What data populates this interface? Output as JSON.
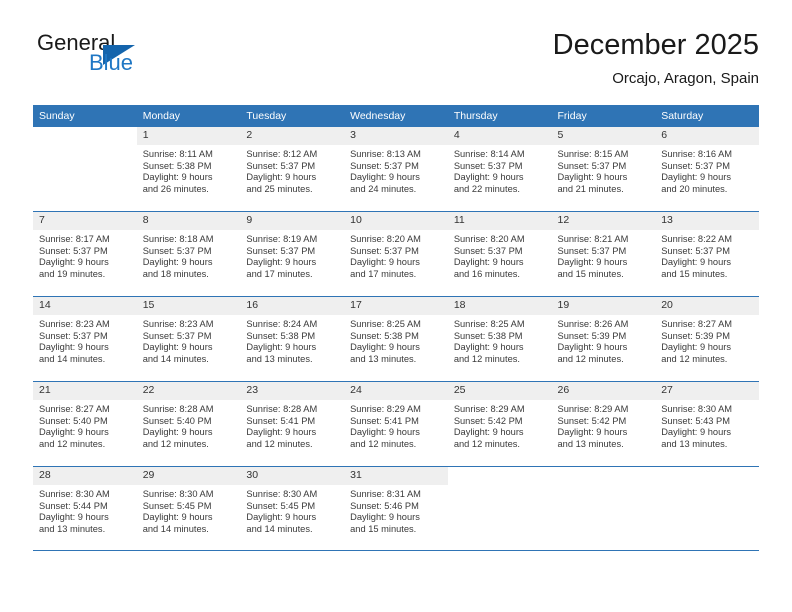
{
  "brand": {
    "name_part1": "General",
    "name_part2": "Blue",
    "logo_icon": "triangle-logo-icon",
    "accent_color": "#1464ac",
    "text_color": "#1f77c4"
  },
  "header": {
    "title": "December 2025",
    "subtitle": "Orcajo, Aragon, Spain"
  },
  "calendar": {
    "header_bg": "#2f74b5",
    "daynum_bg": "#efefef",
    "weekday_headers": [
      "Sunday",
      "Monday",
      "Tuesday",
      "Wednesday",
      "Thursday",
      "Friday",
      "Saturday"
    ],
    "weeks": [
      [
        {
          "day": "",
          "blank": true,
          "empty": false,
          "sunrise": "",
          "sunset": "",
          "daylight_line1": "",
          "daylight_line2": ""
        },
        {
          "day": "1",
          "sunrise": "Sunrise: 8:11 AM",
          "sunset": "Sunset: 5:38 PM",
          "daylight_line1": "Daylight: 9 hours",
          "daylight_line2": "and 26 minutes."
        },
        {
          "day": "2",
          "sunrise": "Sunrise: 8:12 AM",
          "sunset": "Sunset: 5:37 PM",
          "daylight_line1": "Daylight: 9 hours",
          "daylight_line2": "and 25 minutes."
        },
        {
          "day": "3",
          "sunrise": "Sunrise: 8:13 AM",
          "sunset": "Sunset: 5:37 PM",
          "daylight_line1": "Daylight: 9 hours",
          "daylight_line2": "and 24 minutes."
        },
        {
          "day": "4",
          "sunrise": "Sunrise: 8:14 AM",
          "sunset": "Sunset: 5:37 PM",
          "daylight_line1": "Daylight: 9 hours",
          "daylight_line2": "and 22 minutes."
        },
        {
          "day": "5",
          "sunrise": "Sunrise: 8:15 AM",
          "sunset": "Sunset: 5:37 PM",
          "daylight_line1": "Daylight: 9 hours",
          "daylight_line2": "and 21 minutes."
        },
        {
          "day": "6",
          "sunrise": "Sunrise: 8:16 AM",
          "sunset": "Sunset: 5:37 PM",
          "daylight_line1": "Daylight: 9 hours",
          "daylight_line2": "and 20 minutes."
        }
      ],
      [
        {
          "day": "7",
          "sunrise": "Sunrise: 8:17 AM",
          "sunset": "Sunset: 5:37 PM",
          "daylight_line1": "Daylight: 9 hours",
          "daylight_line2": "and 19 minutes."
        },
        {
          "day": "8",
          "sunrise": "Sunrise: 8:18 AM",
          "sunset": "Sunset: 5:37 PM",
          "daylight_line1": "Daylight: 9 hours",
          "daylight_line2": "and 18 minutes."
        },
        {
          "day": "9",
          "sunrise": "Sunrise: 8:19 AM",
          "sunset": "Sunset: 5:37 PM",
          "daylight_line1": "Daylight: 9 hours",
          "daylight_line2": "and 17 minutes."
        },
        {
          "day": "10",
          "sunrise": "Sunrise: 8:20 AM",
          "sunset": "Sunset: 5:37 PM",
          "daylight_line1": "Daylight: 9 hours",
          "daylight_line2": "and 17 minutes."
        },
        {
          "day": "11",
          "sunrise": "Sunrise: 8:20 AM",
          "sunset": "Sunset: 5:37 PM",
          "daylight_line1": "Daylight: 9 hours",
          "daylight_line2": "and 16 minutes."
        },
        {
          "day": "12",
          "sunrise": "Sunrise: 8:21 AM",
          "sunset": "Sunset: 5:37 PM",
          "daylight_line1": "Daylight: 9 hours",
          "daylight_line2": "and 15 minutes."
        },
        {
          "day": "13",
          "sunrise": "Sunrise: 8:22 AM",
          "sunset": "Sunset: 5:37 PM",
          "daylight_line1": "Daylight: 9 hours",
          "daylight_line2": "and 15 minutes."
        }
      ],
      [
        {
          "day": "14",
          "sunrise": "Sunrise: 8:23 AM",
          "sunset": "Sunset: 5:37 PM",
          "daylight_line1": "Daylight: 9 hours",
          "daylight_line2": "and 14 minutes."
        },
        {
          "day": "15",
          "sunrise": "Sunrise: 8:23 AM",
          "sunset": "Sunset: 5:37 PM",
          "daylight_line1": "Daylight: 9 hours",
          "daylight_line2": "and 14 minutes."
        },
        {
          "day": "16",
          "sunrise": "Sunrise: 8:24 AM",
          "sunset": "Sunset: 5:38 PM",
          "daylight_line1": "Daylight: 9 hours",
          "daylight_line2": "and 13 minutes."
        },
        {
          "day": "17",
          "sunrise": "Sunrise: 8:25 AM",
          "sunset": "Sunset: 5:38 PM",
          "daylight_line1": "Daylight: 9 hours",
          "daylight_line2": "and 13 minutes."
        },
        {
          "day": "18",
          "sunrise": "Sunrise: 8:25 AM",
          "sunset": "Sunset: 5:38 PM",
          "daylight_line1": "Daylight: 9 hours",
          "daylight_line2": "and 12 minutes."
        },
        {
          "day": "19",
          "sunrise": "Sunrise: 8:26 AM",
          "sunset": "Sunset: 5:39 PM",
          "daylight_line1": "Daylight: 9 hours",
          "daylight_line2": "and 12 minutes."
        },
        {
          "day": "20",
          "sunrise": "Sunrise: 8:27 AM",
          "sunset": "Sunset: 5:39 PM",
          "daylight_line1": "Daylight: 9 hours",
          "daylight_line2": "and 12 minutes."
        }
      ],
      [
        {
          "day": "21",
          "sunrise": "Sunrise: 8:27 AM",
          "sunset": "Sunset: 5:40 PM",
          "daylight_line1": "Daylight: 9 hours",
          "daylight_line2": "and 12 minutes."
        },
        {
          "day": "22",
          "sunrise": "Sunrise: 8:28 AM",
          "sunset": "Sunset: 5:40 PM",
          "daylight_line1": "Daylight: 9 hours",
          "daylight_line2": "and 12 minutes."
        },
        {
          "day": "23",
          "sunrise": "Sunrise: 8:28 AM",
          "sunset": "Sunset: 5:41 PM",
          "daylight_line1": "Daylight: 9 hours",
          "daylight_line2": "and 12 minutes."
        },
        {
          "day": "24",
          "sunrise": "Sunrise: 8:29 AM",
          "sunset": "Sunset: 5:41 PM",
          "daylight_line1": "Daylight: 9 hours",
          "daylight_line2": "and 12 minutes."
        },
        {
          "day": "25",
          "sunrise": "Sunrise: 8:29 AM",
          "sunset": "Sunset: 5:42 PM",
          "daylight_line1": "Daylight: 9 hours",
          "daylight_line2": "and 12 minutes."
        },
        {
          "day": "26",
          "sunrise": "Sunrise: 8:29 AM",
          "sunset": "Sunset: 5:42 PM",
          "daylight_line1": "Daylight: 9 hours",
          "daylight_line2": "and 13 minutes."
        },
        {
          "day": "27",
          "sunrise": "Sunrise: 8:30 AM",
          "sunset": "Sunset: 5:43 PM",
          "daylight_line1": "Daylight: 9 hours",
          "daylight_line2": "and 13 minutes."
        }
      ],
      [
        {
          "day": "28",
          "sunrise": "Sunrise: 8:30 AM",
          "sunset": "Sunset: 5:44 PM",
          "daylight_line1": "Daylight: 9 hours",
          "daylight_line2": "and 13 minutes."
        },
        {
          "day": "29",
          "sunrise": "Sunrise: 8:30 AM",
          "sunset": "Sunset: 5:45 PM",
          "daylight_line1": "Daylight: 9 hours",
          "daylight_line2": "and 14 minutes."
        },
        {
          "day": "30",
          "sunrise": "Sunrise: 8:30 AM",
          "sunset": "Sunset: 5:45 PM",
          "daylight_line1": "Daylight: 9 hours",
          "daylight_line2": "and 14 minutes."
        },
        {
          "day": "31",
          "sunrise": "Sunrise: 8:31 AM",
          "sunset": "Sunset: 5:46 PM",
          "daylight_line1": "Daylight: 9 hours",
          "daylight_line2": "and 15 minutes."
        },
        {
          "day": "",
          "blank": true,
          "sunrise": "",
          "sunset": "",
          "daylight_line1": "",
          "daylight_line2": ""
        },
        {
          "day": "",
          "blank": true,
          "sunrise": "",
          "sunset": "",
          "daylight_line1": "",
          "daylight_line2": ""
        },
        {
          "day": "",
          "blank": true,
          "sunrise": "",
          "sunset": "",
          "daylight_line1": "",
          "daylight_line2": ""
        }
      ]
    ]
  }
}
